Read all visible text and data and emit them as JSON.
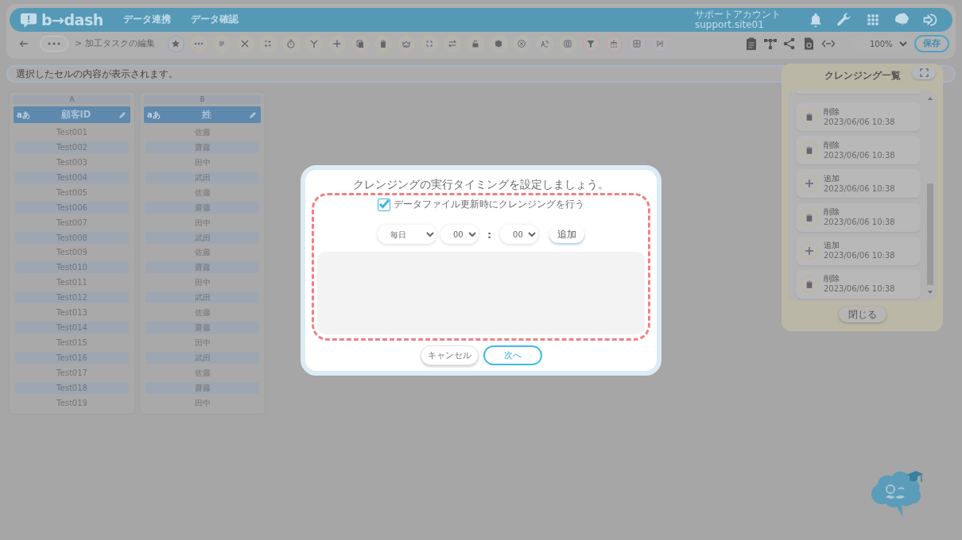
{
  "header": {
    "logo": "b→dash",
    "nav": [
      {
        "label": "データ連携"
      },
      {
        "label": "データ確認"
      }
    ],
    "account": {
      "name": "サポートアカウント",
      "id": "support.site01"
    }
  },
  "toolbar": {
    "breadcrumb": "> 加工タスクの編集",
    "zoom": "100%",
    "save": "保存"
  },
  "cell_viewer": {
    "placeholder": "選択したセルの内容が表示されます。"
  },
  "sheet": {
    "columns": [
      {
        "letter": "A",
        "type": "aあ",
        "name": "顧客ID",
        "cells": [
          "Test001",
          "Test002",
          "Test003",
          "Test004",
          "Test005",
          "Test006",
          "Test007",
          "Test008",
          "Test009",
          "Test010",
          "Test011",
          "Test012",
          "Test013",
          "Test014",
          "Test015",
          "Test016",
          "Test017",
          "Test018",
          "Test019"
        ]
      },
      {
        "letter": "B",
        "type": "aあ",
        "name": "姓",
        "cells": [
          "佐藤",
          "齋藤",
          "田中",
          "武田",
          "佐藤",
          "齋藤",
          "田中",
          "武田",
          "佐藤",
          "齋藤",
          "田中",
          "武田",
          "佐藤",
          "齋藤",
          "田中",
          "武田",
          "佐藤",
          "齋藤",
          "田中"
        ]
      }
    ]
  },
  "modal": {
    "title": "クレンジングの実行タイミングを設定しましょう。",
    "checkbox": {
      "label": "データファイル更新時にクレンジングを行う",
      "checked": true
    },
    "frequency": "毎日",
    "hour": "00",
    "separator": ":",
    "minute": "00",
    "add": "追加",
    "cancel": "キャンセル",
    "next": "次へ"
  },
  "history_panel": {
    "title": "クレンジング一覧",
    "entries": [
      {
        "kind": "delete",
        "action": "削除",
        "time": "2023/06/06 10:38"
      },
      {
        "kind": "delete",
        "action": "削除",
        "time": "2023/06/06 10:38"
      },
      {
        "kind": "add",
        "action": "追加",
        "time": "2023/06/06 10:38"
      },
      {
        "kind": "delete",
        "action": "削除",
        "time": "2023/06/06 10:38"
      },
      {
        "kind": "add",
        "action": "追加",
        "time": "2023/06/06 10:38"
      },
      {
        "kind": "delete",
        "action": "削除",
        "time": "2023/06/06 10:38"
      }
    ],
    "close": "閉じる"
  }
}
